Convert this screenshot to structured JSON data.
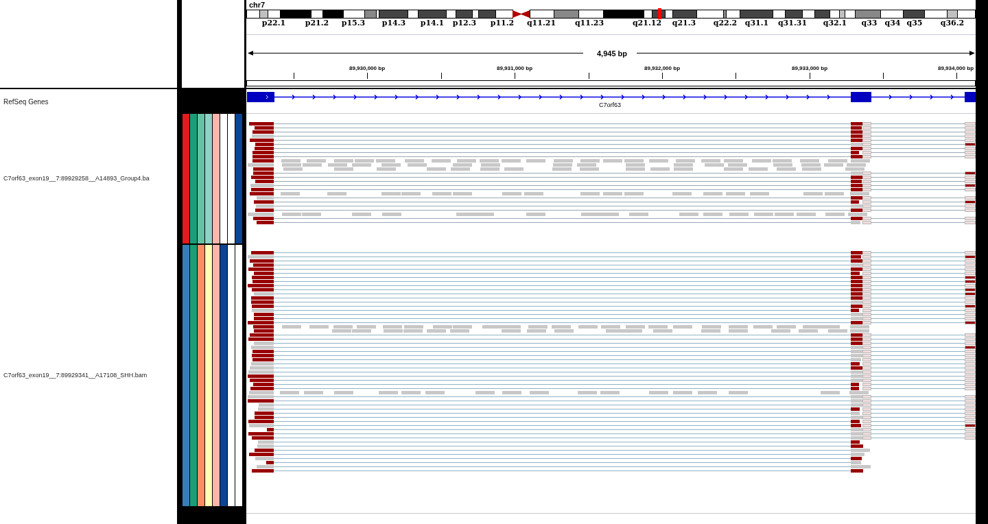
{
  "chromosome": "chr7",
  "bands": [
    "p22.1",
    "p21.2",
    "p15.3",
    "p14.3",
    "p14.1",
    "p12.3",
    "p11.2",
    "q11.21",
    "q11.23",
    "q21.12",
    "q21.3",
    "q22.2",
    "q31.1",
    "q31.31",
    "q32.1",
    "q33",
    "q34",
    "q35",
    "q36.2"
  ],
  "ruler": {
    "span": "4,945 bp",
    "ticks": [
      "89,930,000 bp",
      "89,931,000 bp",
      "89,932,000 bp",
      "89,933,000 bp",
      "89,934,000 bp"
    ]
  },
  "gene_track": {
    "name": "RefSeq Genes",
    "gene": "C7orf63"
  },
  "tracks": [
    {
      "name": "C7orf63_exon19__7:89929258__A14893_Group4.ba",
      "attributes": [
        {
          "color": "#e41a1c"
        },
        {
          "color": "#1b9e77"
        },
        {
          "color": "#66c2a5"
        },
        {
          "color": "#8dd3c7"
        },
        {
          "color": "#fbb4ae"
        },
        {
          "color": "#ffffff"
        },
        {
          "color": "#ffffff"
        },
        {
          "color": "#0b4594"
        }
      ]
    },
    {
      "name": "C7orf63_exon19__7:89929341__A17108_SHH.bam",
      "attributes": [
        {
          "color": "#377eb8"
        },
        {
          "color": "#1b9e77"
        },
        {
          "color": "#fc8d62"
        },
        {
          "color": "#ffffb3"
        },
        {
          "color": "#fbb4ae"
        },
        {
          "color": "#0b4594"
        },
        {
          "color": "#ffffff"
        },
        {
          "color": "#ffffff"
        }
      ]
    }
  ]
}
